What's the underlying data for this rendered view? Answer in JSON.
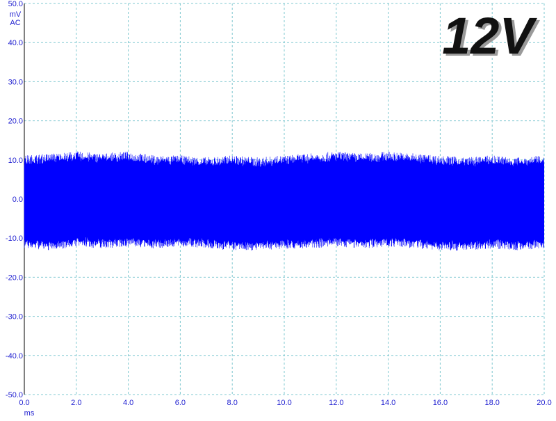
{
  "chart_data": {
    "type": "line",
    "title": "",
    "badge_text": "12V",
    "y_unit": "mV",
    "y_coupling": "AC",
    "x_unit": "ms",
    "xlim": [
      0,
      20
    ],
    "ylim": [
      -50,
      50
    ],
    "x_ticks": [
      "0.0",
      "2.0",
      "4.0",
      "6.0",
      "8.0",
      "10.0",
      "12.0",
      "14.0",
      "16.0",
      "18.0",
      "20.0"
    ],
    "y_ticks": [
      "50.0",
      "40.0",
      "30.0",
      "20.0",
      "10.0",
      "0.0",
      "-10.0",
      "-20.0",
      "-30.0",
      "-40.0",
      "-50.0"
    ],
    "grid": true,
    "grid_color": "#7fc8d0",
    "trace_color": "#0000ff",
    "badge_color": "#111111",
    "series": [
      {
        "description_of_shape": "dense ripple noise band centered at 0",
        "x": [
          0,
          1,
          2,
          3,
          4,
          5,
          6,
          7,
          8,
          9,
          10,
          11,
          12,
          13,
          14,
          15,
          16,
          17,
          18,
          19,
          20
        ],
        "upper": [
          10,
          10.5,
          11,
          10.5,
          11,
          10,
          10,
          9.5,
          10,
          9.5,
          10,
          10.5,
          11,
          10.5,
          11,
          10.5,
          10,
          9.5,
          10,
          9.5,
          10
        ],
        "lower": [
          -11.5,
          -12,
          -11,
          -11.5,
          -11,
          -11.5,
          -11,
          -11.5,
          -12,
          -12,
          -11.5,
          -11.5,
          -11,
          -11.5,
          -11,
          -11.5,
          -12,
          -12,
          -11.5,
          -12,
          -11.5
        ]
      }
    ]
  }
}
